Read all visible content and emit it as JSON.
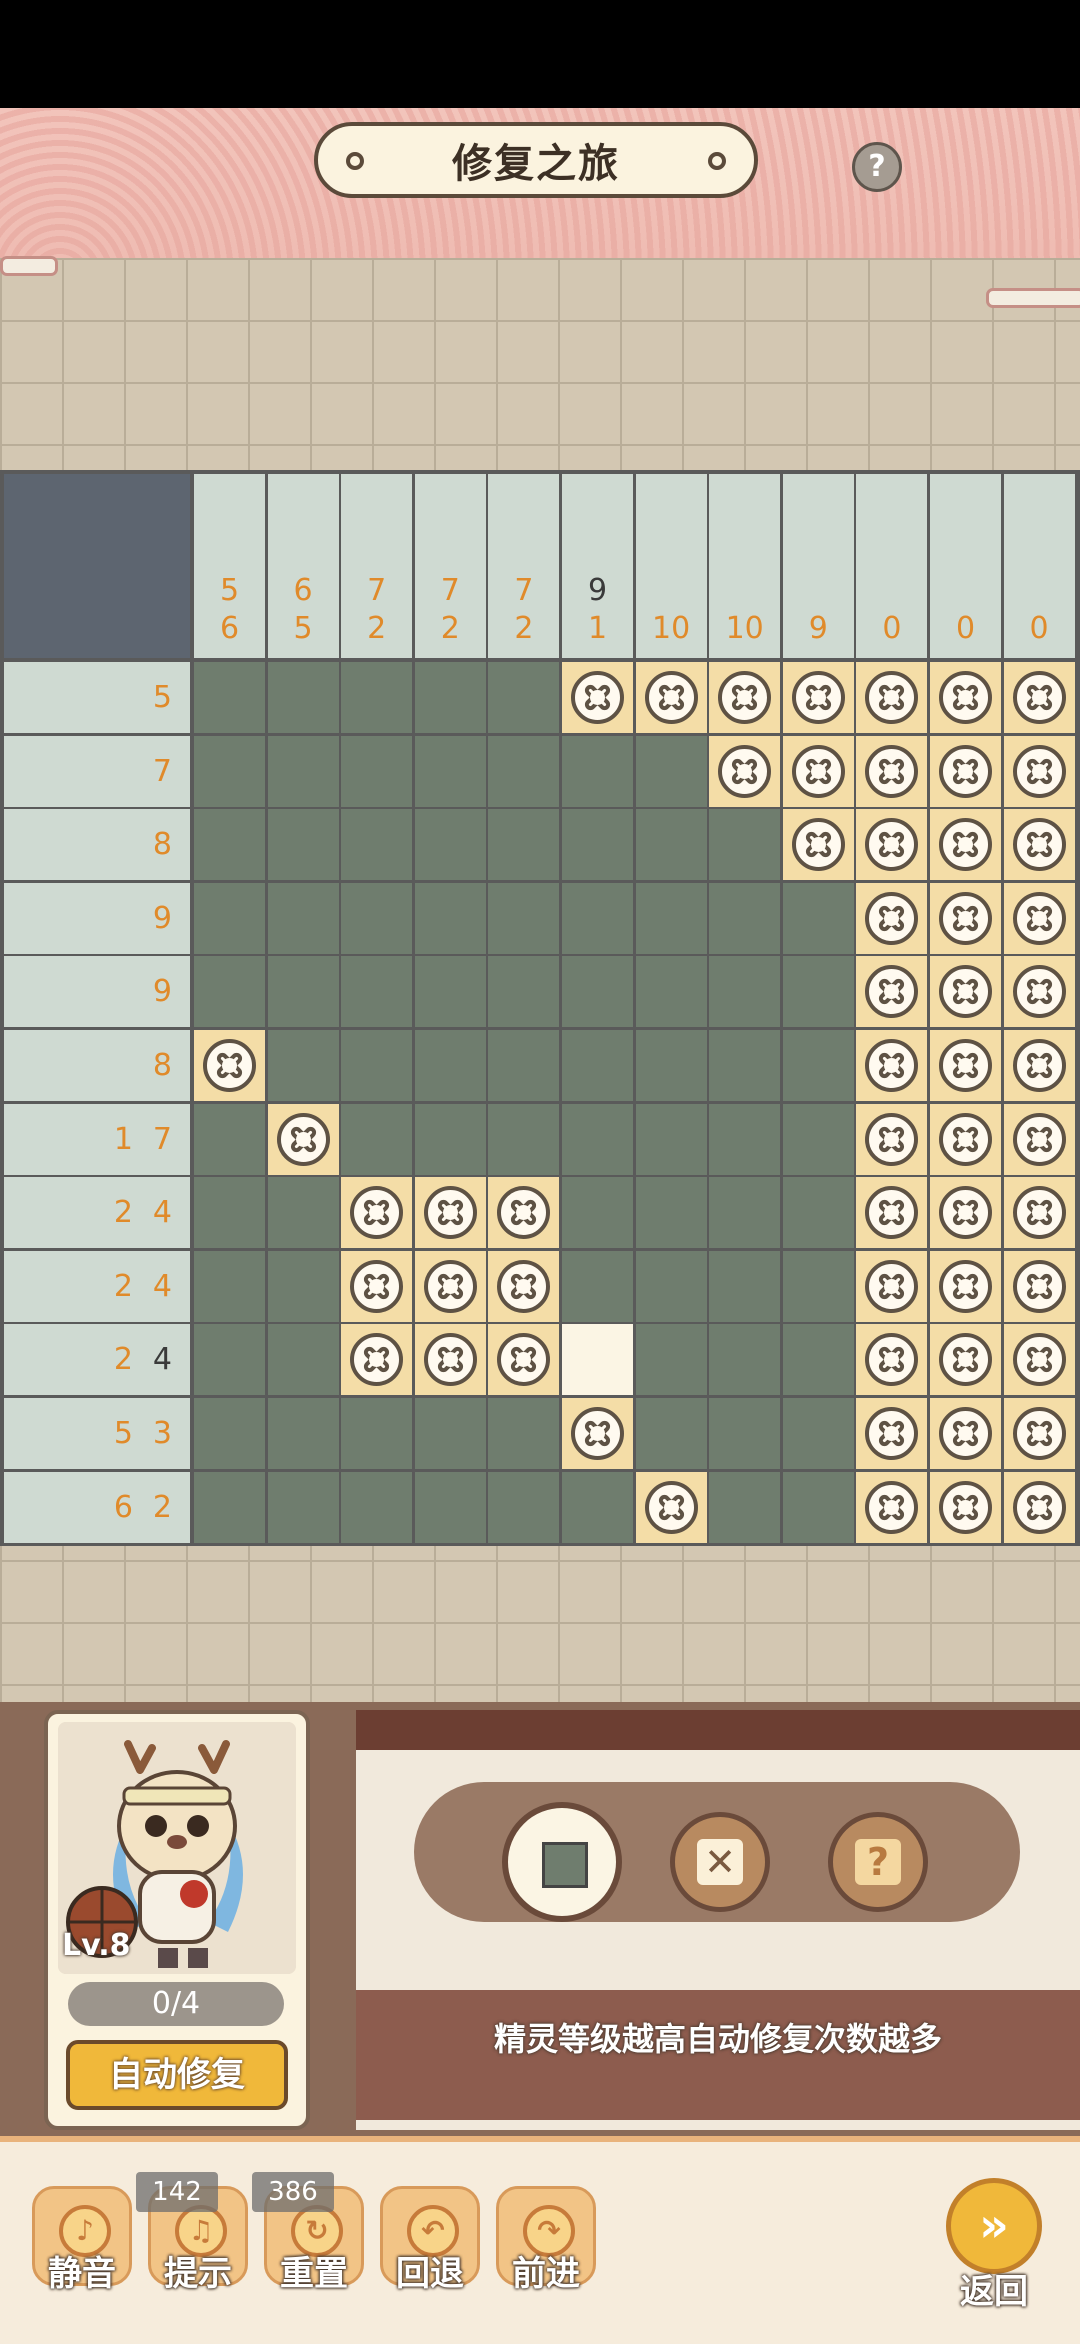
{
  "header": {
    "title": "修复之旅",
    "help_icon": "question-icon"
  },
  "puzzle": {
    "col_clues": [
      [
        "5",
        "6"
      ],
      [
        "6",
        "5"
      ],
      [
        "7",
        "2"
      ],
      [
        "7",
        "2"
      ],
      [
        "7",
        "2"
      ],
      [
        "9",
        "1"
      ],
      [
        "10"
      ],
      [
        "10"
      ],
      [
        "9"
      ],
      [
        "0"
      ],
      [
        "0"
      ],
      [
        "0"
      ]
    ],
    "row_clues": [
      [
        "5"
      ],
      [
        "7"
      ],
      [
        "8"
      ],
      [
        "9"
      ],
      [
        "9"
      ],
      [
        "8"
      ],
      [
        "1",
        "7"
      ],
      [
        "2",
        "4"
      ],
      [
        "2",
        "4"
      ],
      [
        "2",
        "4"
      ],
      [
        "5",
        "3"
      ],
      [
        "6",
        "2"
      ]
    ],
    "grid": [
      "FFFFFXXXXXXX",
      "FFFFFFFXXXXX",
      "FFFFFFFFXXXX",
      "FFFFFFFFFXXX",
      "FFFFFFFFFXXX",
      "XFFFFFFFFXXX",
      "FXFFFFFFFXXX",
      "FFXXXFFFFXXX",
      "FFXXXFFFFXXX",
      "FFXXXEFFFXXX",
      "FFFFFXFFFXXX",
      "FFFFFFXFFXXX"
    ]
  },
  "spirit": {
    "level": "Lv.8",
    "progress": "0/4",
    "auto_button": "自动修复"
  },
  "tools": {
    "fill": "filled-square-icon",
    "cross": "cross-icon",
    "mark": "question-icon"
  },
  "tip": "精灵等级越高自动修复次数越多",
  "footer": {
    "mute": "静音",
    "hint": "提示",
    "hint_count": "142",
    "reset": "重置",
    "reset_count": "386",
    "undo": "回退",
    "redo": "前进",
    "back": "返回"
  }
}
